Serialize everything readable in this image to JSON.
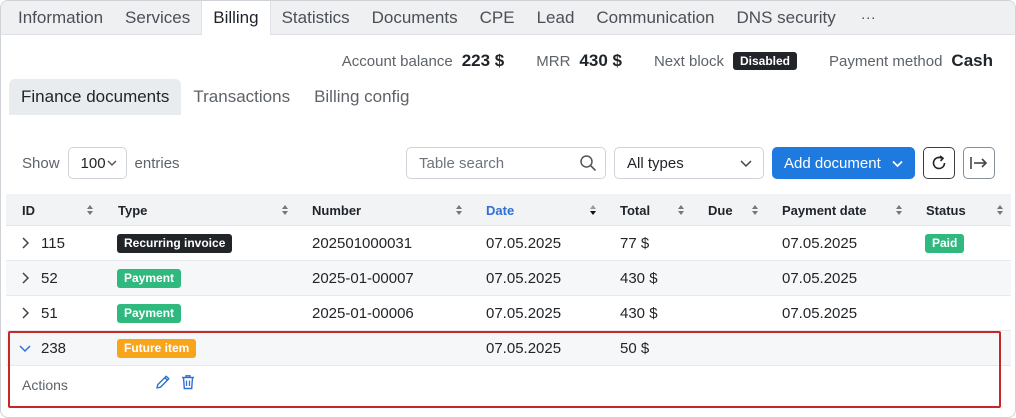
{
  "top_tabs": [
    "Information",
    "Services",
    "Billing",
    "Statistics",
    "Documents",
    "CPE",
    "Lead",
    "Communication",
    "DNS security",
    "···"
  ],
  "active_top_tab": "Billing",
  "summary": {
    "account_balance_label": "Account balance",
    "account_balance_value": "223 $",
    "mrr_label": "MRR",
    "mrr_value": "430 $",
    "next_block_label": "Next block",
    "next_block_value": "Disabled",
    "payment_method_label": "Payment method",
    "payment_method_value": "Cash"
  },
  "sub_tabs": [
    "Finance documents",
    "Transactions",
    "Billing config"
  ],
  "controls": {
    "show_label": "Show",
    "page_length": "100",
    "entries_label": "entries",
    "search_placeholder": "Table search",
    "type_filter": "All types",
    "add_button": "Add document"
  },
  "table": {
    "columns": [
      "ID",
      "Type",
      "Number",
      "Date",
      "Total",
      "Due",
      "Payment date",
      "Status"
    ],
    "sorted_column": "Date",
    "rows": [
      {
        "id": "115",
        "type": "Recurring invoice",
        "type_color": "dark",
        "number": "202501000031",
        "date": "07.05.2025",
        "total": "77 $",
        "due": "",
        "payment_date": "07.05.2025",
        "status": "Paid"
      },
      {
        "id": "52",
        "type": "Payment",
        "type_color": "green",
        "number": "2025-01-00007",
        "date": "07.05.2025",
        "total": "430 $",
        "due": "",
        "payment_date": "07.05.2025",
        "status": ""
      },
      {
        "id": "51",
        "type": "Payment",
        "type_color": "green",
        "number": "2025-01-00006",
        "date": "07.05.2025",
        "total": "430 $",
        "due": "",
        "payment_date": "07.05.2025",
        "status": ""
      },
      {
        "id": "238",
        "type": "Future item",
        "type_color": "orange",
        "number": "",
        "date": "07.05.2025",
        "total": "50 $",
        "due": "",
        "payment_date": "",
        "status": ""
      }
    ],
    "expanded": {
      "actions_label": "Actions"
    }
  },
  "colors": {
    "primary": "#1f7ae0",
    "paid": "#2fb97f",
    "future": "#f8a51c",
    "dark_badge": "#212529",
    "highlight": "#c62828"
  },
  "icons": [
    "search-icon",
    "chevron-down-icon",
    "refresh-icon",
    "export-icon",
    "sort-icon",
    "chevron-right-icon",
    "pencil-icon",
    "trash-icon"
  ]
}
